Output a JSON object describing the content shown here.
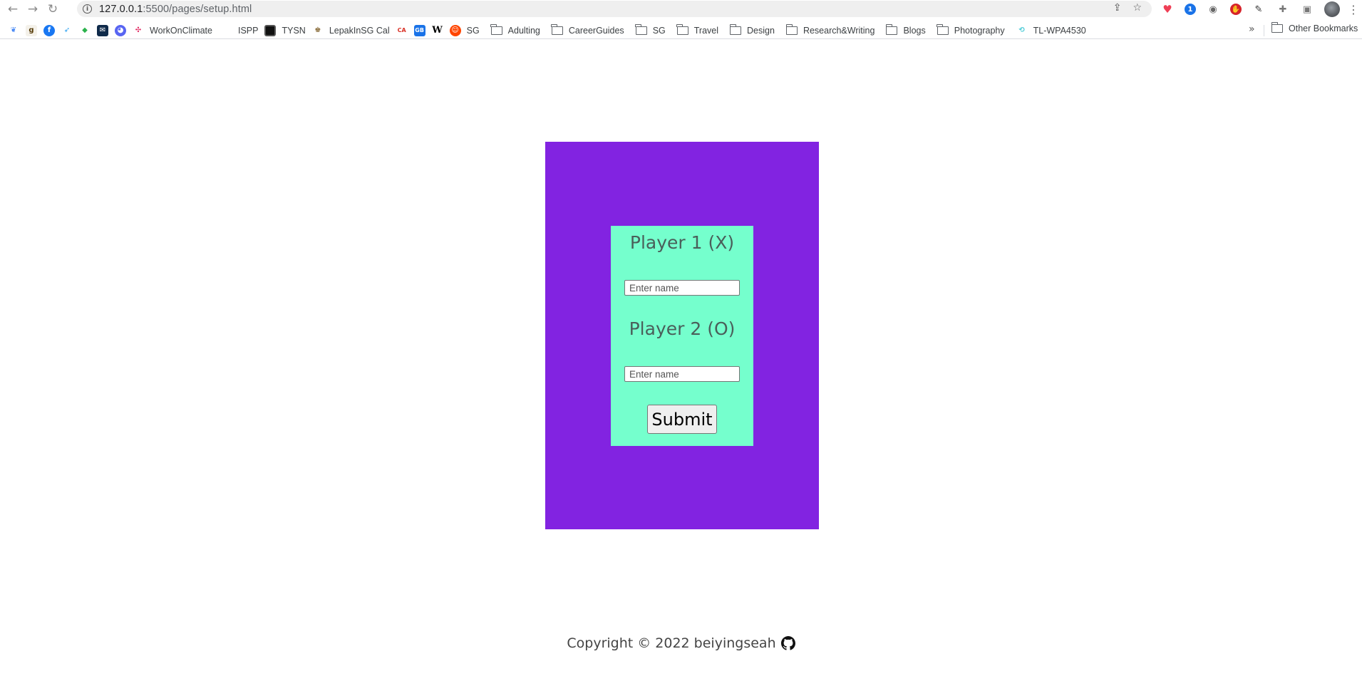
{
  "browser": {
    "url_host": "127.0.0.1",
    "url_path": ":5500/pages/setup.html",
    "nav": {
      "back": "←",
      "forward": "→",
      "reload": "↻"
    },
    "omnibox_icons": [
      "share-icon",
      "star-icon"
    ],
    "extensions": [
      "pocket-icon",
      "1password-icon",
      "camera-icon",
      "stop-icon",
      "pen-icon",
      "puzzle-icon",
      "side-panel-icon",
      "avatar",
      "menu-icon"
    ]
  },
  "bookmarks": {
    "items": [
      {
        "label": "",
        "icon": "tree-icon"
      },
      {
        "label": "",
        "icon": "goodreads-icon"
      },
      {
        "label": "",
        "icon": "facebook-icon"
      },
      {
        "label": "",
        "icon": "twitter-icon"
      },
      {
        "label": "",
        "icon": "feedly-icon"
      },
      {
        "label": "",
        "icon": "mail-icon"
      },
      {
        "label": "",
        "icon": "discord-icon"
      },
      {
        "label": "WorkOnClimate",
        "icon": "slack-icon"
      },
      {
        "label": "ISPP",
        "icon": "blank-icon"
      },
      {
        "label": "TYSN",
        "icon": "square-icon"
      },
      {
        "label": "LepakInSG Cal",
        "icon": "lepak-icon"
      },
      {
        "label": "",
        "icon": "cape-icon"
      },
      {
        "label": "",
        "icon": "gb-icon"
      },
      {
        "label": "",
        "icon": "wikipedia-icon"
      },
      {
        "label": "SG",
        "icon": "reddit-icon"
      },
      {
        "label": "Adulting",
        "icon": "folder-icon"
      },
      {
        "label": "CareerGuides",
        "icon": "folder-icon"
      },
      {
        "label": "SG",
        "icon": "folder-icon"
      },
      {
        "label": "Travel",
        "icon": "folder-icon"
      },
      {
        "label": "Design",
        "icon": "folder-icon"
      },
      {
        "label": "Research&Writing",
        "icon": "folder-icon"
      },
      {
        "label": "Blogs",
        "icon": "folder-icon"
      },
      {
        "label": "Photography",
        "icon": "folder-icon"
      },
      {
        "label": "TL-WPA4530",
        "icon": "tplink-icon"
      }
    ],
    "overflow": "»",
    "other": "Other Bookmarks"
  },
  "form": {
    "player1_heading": "Player 1 (X)",
    "player1_placeholder": "Enter name",
    "player2_heading": "Player 2 (O)",
    "player2_placeholder": "Enter name",
    "submit_label": "Submit"
  },
  "footer": {
    "text": "Copyright © 2022 beiyingseah"
  },
  "colors": {
    "outer_box": "#8223e1",
    "card": "#75ffcd"
  }
}
